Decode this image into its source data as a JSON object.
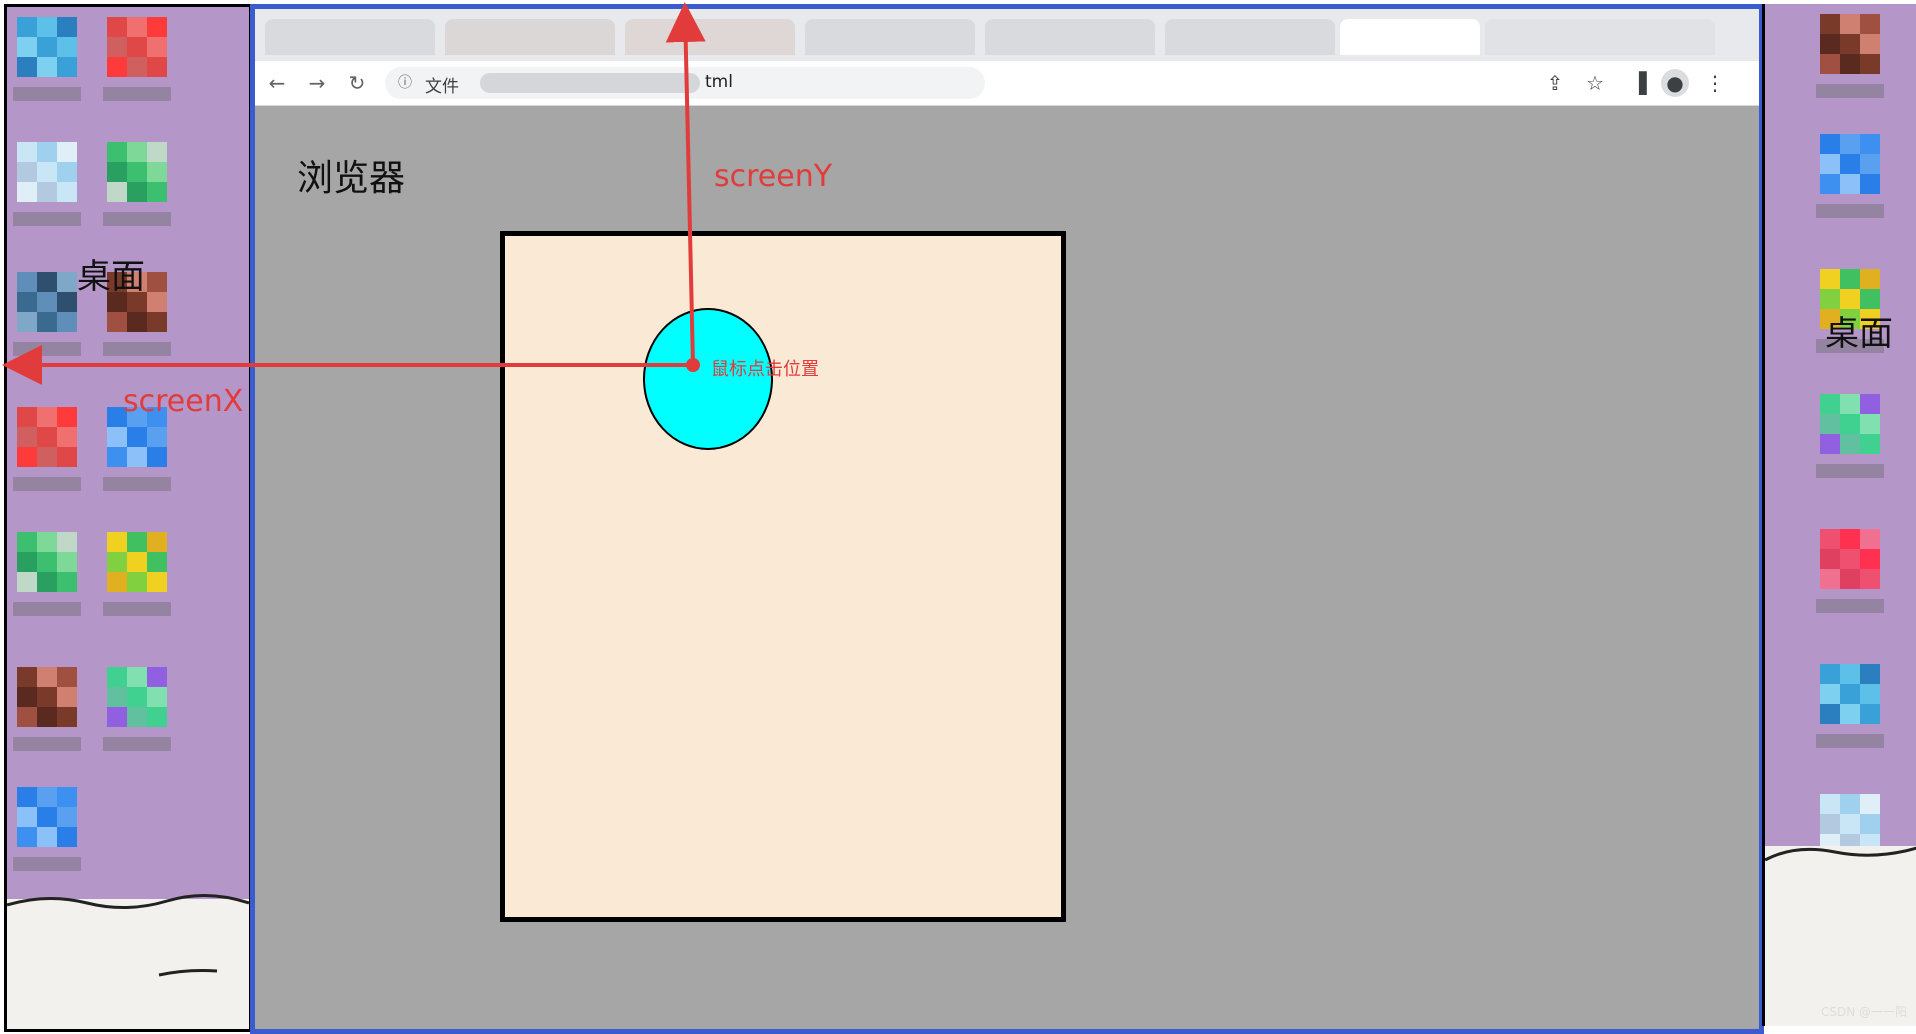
{
  "desktop": {
    "label_left": "桌面",
    "label_right": "桌面",
    "color": "#b496c8",
    "watermark": "CSDN @一一阳"
  },
  "browser": {
    "label": "浏览器",
    "frame_color": "#3b5ccf",
    "address": {
      "scheme_label": "文件",
      "url_suffix": "tml"
    },
    "nav_icons": [
      "back-arrow-icon",
      "forward-arrow-icon",
      "reload-icon"
    ],
    "toolbar_icons": [
      "share-icon",
      "star-icon",
      "side-panel-icon",
      "profile-icon",
      "menu-icon"
    ]
  },
  "diagram": {
    "screenX_label": "screenX",
    "screenY_label": "screenY",
    "click_label": "鼠标点击位置",
    "arrow_color": "#e23b3b",
    "circle_color": "#00ffff",
    "page_color": "#fae9d5"
  }
}
